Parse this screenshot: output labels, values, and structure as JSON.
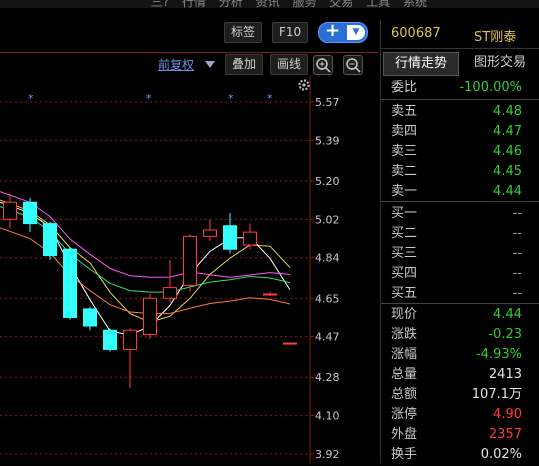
{
  "top_menu": [
    "三?",
    "行情",
    "分析",
    "资讯",
    "服务",
    "交易",
    "工具",
    "系统"
  ],
  "toolbar": {
    "label_btn": "标签",
    "f10_btn": "F10",
    "plus": "+",
    "dropdown": "▼"
  },
  "chart_header": {
    "fuquan": "前复权",
    "add_btn": "叠加",
    "draw_btn": "画线"
  },
  "icons": {
    "zoom_in": "zoom-in-icon",
    "zoom_out": "zoom-out-icon",
    "settings": "gear-icon"
  },
  "colors": {
    "up": "#ff3b3b",
    "down": "#33ffff",
    "ma_white": "#ffffff",
    "ma_yellow": "#e8d44d",
    "ma_magenta": "#ff5aff",
    "ma_green": "#2ee07a",
    "ma_orange": "#ff7a3a",
    "grid": "#8b1a1a"
  },
  "chart_data": {
    "type": "candlestick",
    "y_ticks": [
      "5.57",
      "5.39",
      "5.20",
      "5.02",
      "4.84",
      "4.65",
      "4.47",
      "4.28",
      "4.10",
      "3.92"
    ],
    "ylim": [
      3.92,
      5.57
    ],
    "candles": [
      {
        "o": 5.02,
        "c": 5.1,
        "h": 5.14,
        "l": 4.98
      },
      {
        "o": 5.1,
        "c": 5.0,
        "h": 5.12,
        "l": 4.96
      },
      {
        "o": 5.0,
        "c": 4.85,
        "h": 5.01,
        "l": 4.83
      },
      {
        "o": 4.88,
        "c": 4.56,
        "h": 4.89,
        "l": 4.55
      },
      {
        "o": 4.6,
        "c": 4.52,
        "h": 4.61,
        "l": 4.5
      },
      {
        "o": 4.5,
        "c": 4.41,
        "h": 4.51,
        "l": 4.4
      },
      {
        "o": 4.41,
        "c": 4.5,
        "h": 4.51,
        "l": 4.23
      },
      {
        "o": 4.48,
        "c": 4.65,
        "h": 4.67,
        "l": 4.46
      },
      {
        "o": 4.65,
        "c": 4.7,
        "h": 4.83,
        "l": 4.63
      },
      {
        "o": 4.71,
        "c": 4.94,
        "h": 4.95,
        "l": 4.68
      },
      {
        "o": 4.94,
        "c": 4.97,
        "h": 5.02,
        "l": 4.92
      },
      {
        "o": 4.99,
        "c": 4.88,
        "h": 5.05,
        "l": 4.86
      },
      {
        "o": 4.9,
        "c": 4.96,
        "h": 5.0,
        "l": 4.88
      },
      {
        "o": 4.67,
        "c": 4.67,
        "h": 4.68,
        "l": 4.66
      },
      {
        "o": 4.44,
        "c": 4.44,
        "h": 4.44,
        "l": 4.44
      }
    ]
  },
  "quote": {
    "code": "600687",
    "name": "ST刚泰",
    "tab_active": "行情走势",
    "tab_other": "图形交易",
    "weibi": {
      "label": "委比",
      "value": "-100.00%"
    },
    "sells": [
      {
        "label": "卖五",
        "value": "4.48"
      },
      {
        "label": "卖四",
        "value": "4.47"
      },
      {
        "label": "卖三",
        "value": "4.46"
      },
      {
        "label": "卖二",
        "value": "4.45"
      },
      {
        "label": "卖一",
        "value": "4.44"
      }
    ],
    "buys": [
      {
        "label": "买一",
        "value": "--"
      },
      {
        "label": "买二",
        "value": "--"
      },
      {
        "label": "买三",
        "value": "--"
      },
      {
        "label": "买四",
        "value": "--"
      },
      {
        "label": "买五",
        "value": "--"
      }
    ],
    "stats": [
      {
        "label": "现价",
        "value": "4.44",
        "color": "green"
      },
      {
        "label": "涨跌",
        "value": "-0.23",
        "color": "green"
      },
      {
        "label": "涨幅",
        "value": "-4.93%",
        "color": "green"
      },
      {
        "label": "总量",
        "value": "2413",
        "color": "white"
      },
      {
        "label": "总额",
        "value": "107.1万",
        "color": "white"
      },
      {
        "label": "涨停",
        "value": "4.90",
        "color": "red"
      },
      {
        "label": "外盘",
        "value": "2357",
        "color": "red"
      },
      {
        "label": "换手",
        "value": "0.02%",
        "color": "white"
      }
    ]
  }
}
